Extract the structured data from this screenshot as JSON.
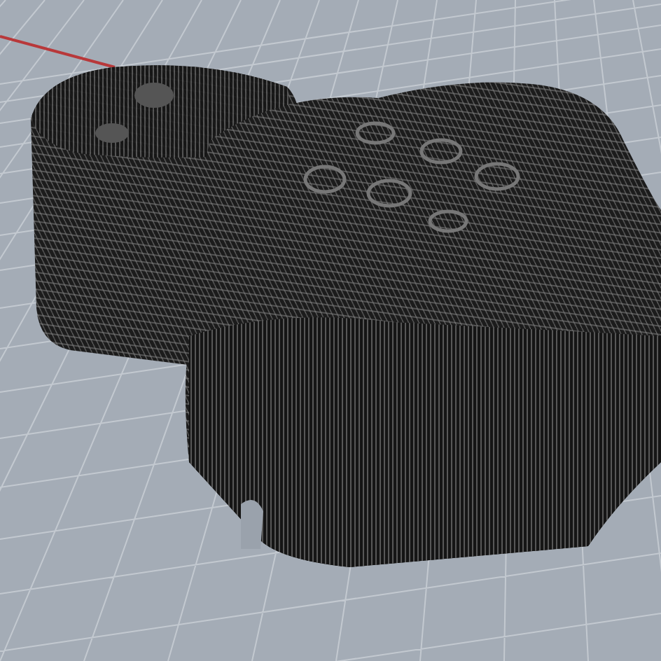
{
  "viewport": {
    "grid_visible": true,
    "x_axis_visible": true
  }
}
